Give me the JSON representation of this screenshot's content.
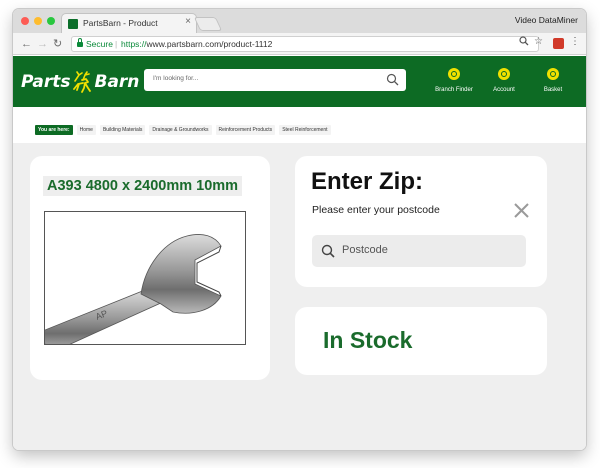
{
  "browser": {
    "tab_title": "PartsBarn - Product",
    "tab_close": "×",
    "profile_name": "Video DataMiner",
    "secure_label": "Secure",
    "url_scheme": "https://",
    "url_rest": "www.partsbarn.com/product-1112"
  },
  "site": {
    "logo_word1": "Parts",
    "logo_word2": "Barn",
    "search_placeholder": "I'm looking for...",
    "header_items": [
      {
        "label": "Branch Finder",
        "icon": "location-icon"
      },
      {
        "label": "Account",
        "icon": "account-icon"
      },
      {
        "label": "Basket",
        "icon": "basket-icon"
      }
    ],
    "colors": {
      "brand_green": "#0d6b24",
      "accent_yellow": "#f0e000",
      "title_green": "#1a6b2c"
    }
  },
  "breadcrumb": {
    "here_label": "You are here:",
    "items": [
      "Home",
      "Building Materials",
      "Drainage & Groundworks",
      "Reinforcement Products",
      "Steel Reinforcement"
    ]
  },
  "product": {
    "title": "A393 4800 x 2400mm 10mm",
    "image_alt": "wrench"
  },
  "zip_panel": {
    "title": "Enter Zip:",
    "subtitle": "Please enter your postcode",
    "placeholder": "Postcode"
  },
  "stock": {
    "status": "In Stock"
  }
}
